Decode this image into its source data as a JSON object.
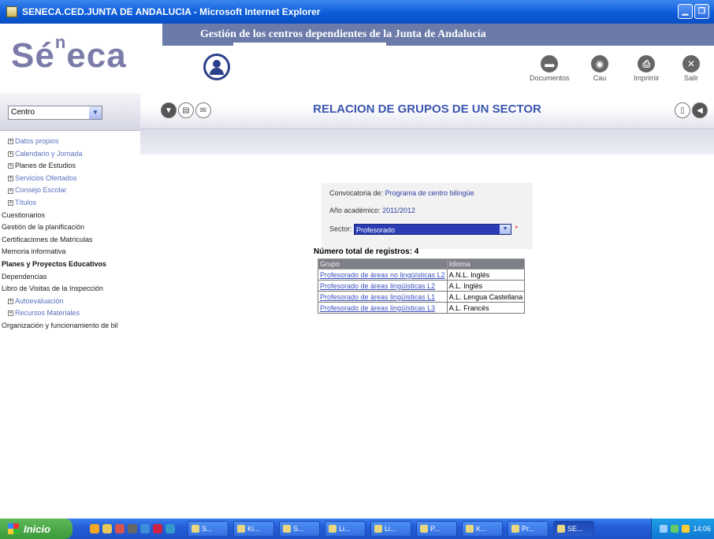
{
  "window": {
    "title": "SENECA.CED.JUNTA DE ANDALUCIA - Microsoft Internet Explorer",
    "minimize_icon": "minimize-icon",
    "maximize_icon": "maximize-icon"
  },
  "header": {
    "band_title": "Gestión de los centros dependientes de la Junta de Andalucía",
    "logo_main": "Sé",
    "logo_sup": "n",
    "logo_end": "eca",
    "tools": [
      {
        "label": "Documentos",
        "icon": "documents-icon"
      },
      {
        "label": "Cau",
        "icon": "cau-icon"
      },
      {
        "label": "Imprimir",
        "icon": "print-icon"
      },
      {
        "label": "Salir",
        "icon": "exit-icon"
      }
    ]
  },
  "sidebar": {
    "selector_value": "Centro",
    "items": [
      {
        "label": "Datos propios",
        "expand": "+"
      },
      {
        "label": "Calendario y Jornada",
        "expand": "+"
      },
      {
        "label": "Planes de Estudios",
        "expand": "+"
      },
      {
        "label": "Servicios Ofertados",
        "expand": "+"
      },
      {
        "label": "Consejo Escolar",
        "expand": "+"
      },
      {
        "label": "Títulos",
        "expand": "+"
      },
      {
        "label": "Cuestionarios"
      },
      {
        "label": "Gestión de la planificación"
      },
      {
        "label": "Certificaciones de Matrículas"
      },
      {
        "label": "Memoria informativa"
      },
      {
        "label": "Planes y Proyectos Educativos"
      },
      {
        "label": "Dependencias"
      },
      {
        "label": "Libro de Visitas de la Inspección"
      },
      {
        "label": "Autoevaluación",
        "expand": "+"
      },
      {
        "label": "Recursos Materiales",
        "expand": "+"
      },
      {
        "label": "Organización y funcionamiento de bil"
      }
    ]
  },
  "main": {
    "title": "RELACION DE GRUPOS DE UN SECTOR",
    "form": {
      "convocatoria_label": "Convocatoria de:",
      "convocatoria_value": "Programa de centro bilingüe",
      "anio_label": "Año académico:",
      "anio_value": "2011/2012",
      "sector_label": "Sector:",
      "sector_value": "Profesorado",
      "required_mark": "*"
    },
    "total_label": "Número total de registros: 4",
    "table": {
      "headers": [
        "Grupo",
        "Idioma"
      ],
      "rows": [
        [
          "Profesorado de áreas no lingüísticas L2",
          "A.N.L. Inglés"
        ],
        [
          "Profesorado de áreas lingüísticas L2",
          "A.L. Inglés"
        ],
        [
          "Profesorado de áreas lingüísticas L1",
          "A.L. Lengua Castellana"
        ],
        [
          "Profesorado de áreas lingüísticas L3",
          "A.L. Francés"
        ]
      ]
    }
  },
  "taskbar": {
    "start_label": "Inicio",
    "tasks": [
      "S...",
      "Ki...",
      "S...",
      "Li...",
      "Li...",
      "P...",
      "K...",
      "Pr...",
      "SE..."
    ],
    "clock": "14:06"
  }
}
